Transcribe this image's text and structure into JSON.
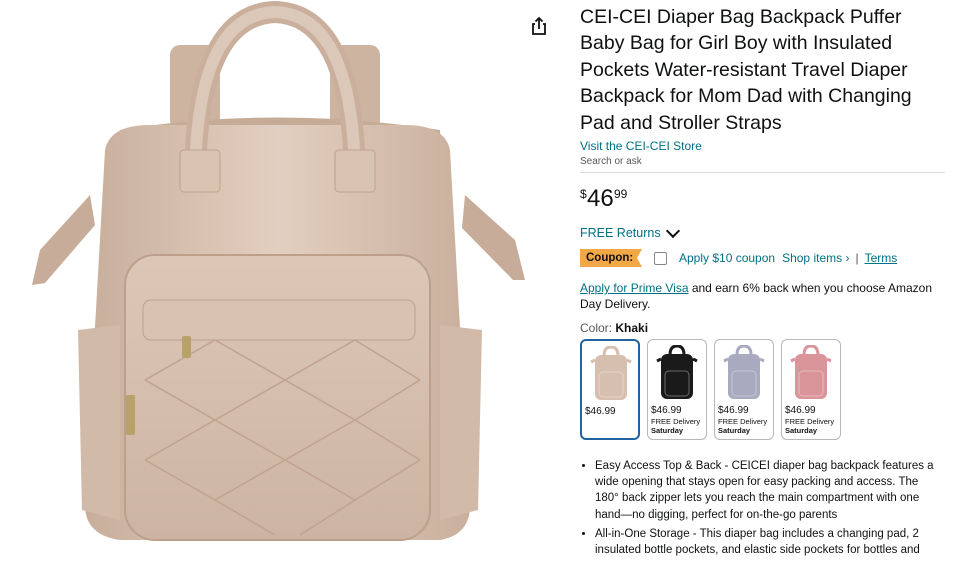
{
  "product": {
    "title": "CEI-CEI Diaper Bag Backpack Puffer Baby Bag for Girl Boy with Insulated Pockets Water-resistant Travel Diaper Backpack for Mom Dad with Changing Pad and Stroller Straps",
    "store_link": "Visit the CEI-CEI Store",
    "search_ask": "Search or ask",
    "price_symbol": "$",
    "price_whole": "46",
    "price_fraction": "99",
    "returns_label": "FREE Returns",
    "coupon_badge": "Coupon:",
    "coupon_apply": "Apply $10 coupon",
    "shop_items": "Shop items ›",
    "separator": "|",
    "terms": "Terms",
    "prime_link": "Apply for Prime Visa",
    "prime_text": " and earn 6% back when you choose Amazon Day Delivery.",
    "color_prefix": "Color: ",
    "color_selected": "Khaki"
  },
  "swatches": [
    {
      "price": "$46.99",
      "delivery": "",
      "day": "",
      "color": "#d6bfae"
    },
    {
      "price": "$46.99",
      "delivery": "FREE Delivery",
      "day": "Saturday",
      "color": "#1a1a1a"
    },
    {
      "price": "$46.99",
      "delivery": "FREE Delivery",
      "day": "Saturday",
      "color": "#a9aabf"
    },
    {
      "price": "$46.99",
      "delivery": "FREE Delivery",
      "day": "Saturday",
      "color": "#d9959a"
    }
  ],
  "bullets": [
    "Easy Access Top & Back - CEICEI diaper bag backpack features a wide opening that stays open for easy packing and access. The 180° back zipper lets you reach the main compartment with one hand—no digging, perfect for on-the-go parents",
    "All-in-One Storage - This diaper bag includes a changing pad, 2 insulated bottle pockets, and elastic side pockets for bottles and"
  ],
  "colors": {
    "link": "#007185",
    "coupon": "#f3a847",
    "selected_border": "#2162a1",
    "bag": "#d6bfae"
  },
  "icons": {
    "share": "share-icon",
    "chevron": "chevron-down-icon"
  }
}
